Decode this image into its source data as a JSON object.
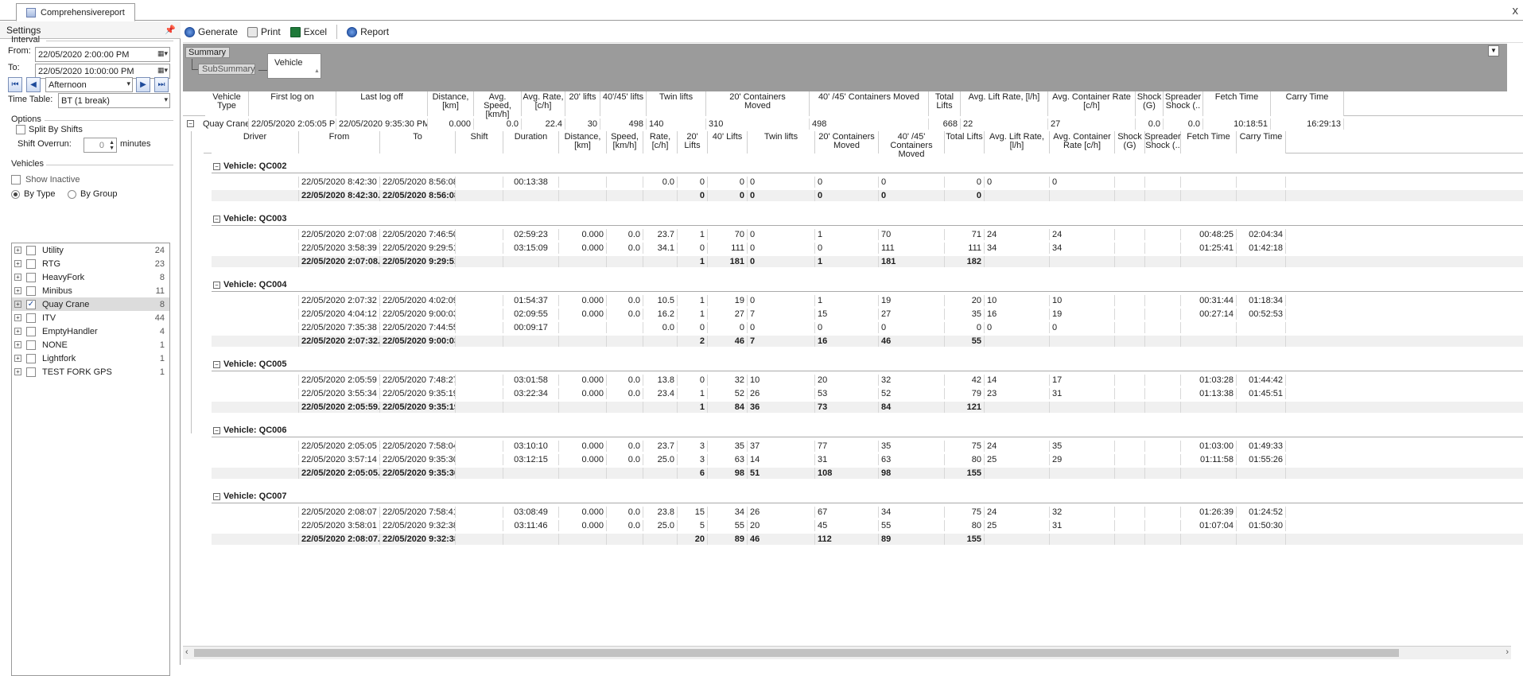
{
  "window": {
    "title": "Comprehensivereport",
    "close": "x"
  },
  "settings": {
    "title": "Settings",
    "interval_label": "Interval",
    "from_label": "From:",
    "from_value": "22/05/2020  2:00:00 PM",
    "to_label": "To:",
    "to_value": "22/05/2020 10:00:00 PM",
    "period_value": "Afternoon",
    "timetable_label": "Time Table:",
    "timetable_value": "BT (1 break)",
    "options_label": "Options",
    "split_label": "Split By Shifts",
    "overrun_label": "Shift Overrun:",
    "overrun_value": "0",
    "overrun_unit": "minutes",
    "vehicles_label": "Vehicles",
    "show_inactive_label": "Show Inactive",
    "by_type_label": "By Type",
    "by_group_label": "By Group",
    "vehicle_types": [
      {
        "name": "Utility",
        "count": "24",
        "checked": false
      },
      {
        "name": "RTG",
        "count": "23",
        "checked": false
      },
      {
        "name": "HeavyFork",
        "count": "8",
        "checked": false
      },
      {
        "name": "Minibus",
        "count": "11",
        "checked": false
      },
      {
        "name": "Quay Crane",
        "count": "8",
        "checked": true
      },
      {
        "name": "ITV",
        "count": "44",
        "checked": false
      },
      {
        "name": "EmptyHandler",
        "count": "4",
        "checked": false
      },
      {
        "name": "NONE",
        "count": "1",
        "checked": false
      },
      {
        "name": "Lightfork",
        "count": "1",
        "checked": false
      },
      {
        "name": "TEST FORK GPS",
        "count": "1",
        "checked": false
      }
    ]
  },
  "toolbar": {
    "generate": "Generate",
    "print": "Print",
    "excel": "Excel",
    "report": "Report"
  },
  "groupzone": {
    "summary": "Summary",
    "subsummary": "SubSummary",
    "vehicle": "Vehicle"
  },
  "top_headers": [
    "Vehicle Type",
    "First log on",
    "Last log off",
    "Distance,\n[km]",
    "Avg. Speed,\n[km/h]",
    "Avg. Rate,\n[c/h]",
    "20' lifts",
    "40'/45' lifts",
    "Twin lifts",
    "20' Containers\nMoved",
    "40' /45' Containers Moved",
    "Total Lifts",
    "Avg. Lift Rate, [l/h]",
    "Avg. Container Rate\n[c/h]",
    "Shock\n(G)",
    "Spreader\nShock (..",
    "Fetch Time",
    "Carry Time"
  ],
  "top_row": [
    "Quay Crane",
    "22/05/2020 2:05:05 PM",
    "22/05/2020 9:35:30 PM",
    "0.000",
    "0.0",
    "22.4",
    "30",
    "498",
    "140",
    "310",
    "498",
    "668",
    "22",
    "27",
    "0.0",
    "0.0",
    "10:18:51",
    "16:29:13"
  ],
  "sub_headers": [
    "Driver",
    "From",
    "To",
    "Shift",
    "Duration",
    "Distance,\n[km]",
    "Speed,\n[km/h]",
    "Rate,\n[c/h]",
    "20' Lifts",
    "40' Lifts",
    "Twin lifts",
    "20' Containers\nMoved",
    "40' /45'\nContainers Moved",
    "Total Lifts",
    "Avg. Lift Rate, [l/h]",
    "Avg. Container\nRate [c/h]",
    "Shock\n(G)",
    "Spreader\nShock (..",
    "Fetch Time",
    "Carry Time"
  ],
  "groups": [
    {
      "title": "Vehicle: QC002",
      "rows": [
        [
          "",
          "22/05/2020  8:42:30  P...",
          "22/05/2020  8:56:08...",
          "",
          "00:13:38",
          "",
          "",
          "0.0",
          "0",
          "0",
          "0",
          "0",
          "0",
          "0",
          "0",
          "0",
          "",
          "",
          "",
          ""
        ]
      ],
      "total": [
        "",
        "22/05/2020 8:42:30...",
        "22/05/2020 8:56:08...",
        "",
        "",
        "",
        "",
        "",
        "0",
        "0",
        "0",
        "0",
        "0",
        "0",
        "",
        "",
        "",
        "",
        "",
        ""
      ]
    },
    {
      "title": "Vehicle: QC003",
      "rows": [
        [
          "",
          "22/05/2020  2:07:08  P...",
          "22/05/2020  7:46:50...",
          "",
          "02:59:23",
          "0.000",
          "0.0",
          "23.7",
          "1",
          "70",
          "0",
          "1",
          "70",
          "71",
          "24",
          "24",
          "",
          "",
          "00:48:25",
          "02:04:34"
        ],
        [
          "",
          "22/05/2020  3:58:39  P...",
          "22/05/2020  9:29:51...",
          "",
          "03:15:09",
          "0.000",
          "0.0",
          "34.1",
          "0",
          "111",
          "0",
          "0",
          "111",
          "111",
          "34",
          "34",
          "",
          "",
          "01:25:41",
          "01:42:18"
        ]
      ],
      "total": [
        "",
        "22/05/2020 2:07:08...",
        "22/05/2020 9:29:51...",
        "",
        "",
        "",
        "",
        "",
        "1",
        "181",
        "0",
        "1",
        "181",
        "182",
        "",
        "",
        "",
        "",
        "",
        ""
      ]
    },
    {
      "title": "Vehicle: QC004",
      "rows": [
        [
          "",
          "22/05/2020  2:07:32  P...",
          "22/05/2020  4:02:09...",
          "",
          "01:54:37",
          "0.000",
          "0.0",
          "10.5",
          "1",
          "19",
          "0",
          "1",
          "19",
          "20",
          "10",
          "10",
          "",
          "",
          "00:31:44",
          "01:18:34"
        ],
        [
          "",
          "22/05/2020  4:04:12  P...",
          "22/05/2020  9:00:03...",
          "",
          "02:09:55",
          "0.000",
          "0.0",
          "16.2",
          "1",
          "27",
          "7",
          "15",
          "27",
          "35",
          "16",
          "19",
          "",
          "",
          "00:27:14",
          "00:52:53"
        ],
        [
          "",
          "22/05/2020  7:35:38  P...",
          "22/05/2020  7:44:55...",
          "",
          "00:09:17",
          "",
          "",
          "0.0",
          "0",
          "0",
          "0",
          "0",
          "0",
          "0",
          "0",
          "0",
          "",
          "",
          "",
          ""
        ]
      ],
      "total": [
        "",
        "22/05/2020 2:07:32...",
        "22/05/2020 9:00:03...",
        "",
        "",
        "",
        "",
        "",
        "2",
        "46",
        "7",
        "16",
        "46",
        "55",
        "",
        "",
        "",
        "",
        "",
        ""
      ]
    },
    {
      "title": "Vehicle: QC005",
      "rows": [
        [
          "",
          "22/05/2020  2:05:59  P...",
          "22/05/2020  7:48:27...",
          "",
          "03:01:58",
          "0.000",
          "0.0",
          "13.8",
          "0",
          "32",
          "10",
          "20",
          "32",
          "42",
          "14",
          "17",
          "",
          "",
          "01:03:28",
          "01:44:42"
        ],
        [
          "",
          "22/05/2020  3:55:34  P...",
          "22/05/2020  9:35:19...",
          "",
          "03:22:34",
          "0.000",
          "0.0",
          "23.4",
          "1",
          "52",
          "26",
          "53",
          "52",
          "79",
          "23",
          "31",
          "",
          "",
          "01:13:38",
          "01:45:51"
        ]
      ],
      "total": [
        "",
        "22/05/2020 2:05:59...",
        "22/05/2020 9:35:19...",
        "",
        "",
        "",
        "",
        "",
        "1",
        "84",
        "36",
        "73",
        "84",
        "121",
        "",
        "",
        "",
        "",
        "",
        ""
      ]
    },
    {
      "title": "Vehicle: QC006",
      "rows": [
        [
          "",
          "22/05/2020  2:05:05  P...",
          "22/05/2020  7:58:04...",
          "",
          "03:10:10",
          "0.000",
          "0.0",
          "23.7",
          "3",
          "35",
          "37",
          "77",
          "35",
          "75",
          "24",
          "35",
          "",
          "",
          "01:03:00",
          "01:49:33"
        ],
        [
          "",
          "22/05/2020  3:57:14  P...",
          "22/05/2020  9:35:30...",
          "",
          "03:12:15",
          "0.000",
          "0.0",
          "25.0",
          "3",
          "63",
          "14",
          "31",
          "63",
          "80",
          "25",
          "29",
          "",
          "",
          "01:11:58",
          "01:55:26"
        ]
      ],
      "total": [
        "",
        "22/05/2020 2:05:05...",
        "22/05/2020 9:35:30...",
        "",
        "",
        "",
        "",
        "",
        "6",
        "98",
        "51",
        "108",
        "98",
        "155",
        "",
        "",
        "",
        "",
        "",
        ""
      ]
    },
    {
      "title": "Vehicle: QC007",
      "rows": [
        [
          "",
          "22/05/2020  2:08:07  P...",
          "22/05/2020  7:58:41...",
          "",
          "03:08:49",
          "0.000",
          "0.0",
          "23.8",
          "15",
          "34",
          "26",
          "67",
          "34",
          "75",
          "24",
          "32",
          "",
          "",
          "01:26:39",
          "01:24:52"
        ],
        [
          "",
          "22/05/2020  3:58:01  P...",
          "22/05/2020  9:32:38...",
          "",
          "03:11:46",
          "0.000",
          "0.0",
          "25.0",
          "5",
          "55",
          "20",
          "45",
          "55",
          "80",
          "25",
          "31",
          "",
          "",
          "01:07:04",
          "01:50:30"
        ]
      ],
      "total": [
        "",
        "22/05/2020 2:08:07...",
        "22/05/2020 9:32:38...",
        "",
        "",
        "",
        "",
        "",
        "20",
        "89",
        "46",
        "112",
        "89",
        "155",
        "",
        "",
        "",
        "",
        "",
        ""
      ]
    }
  ]
}
